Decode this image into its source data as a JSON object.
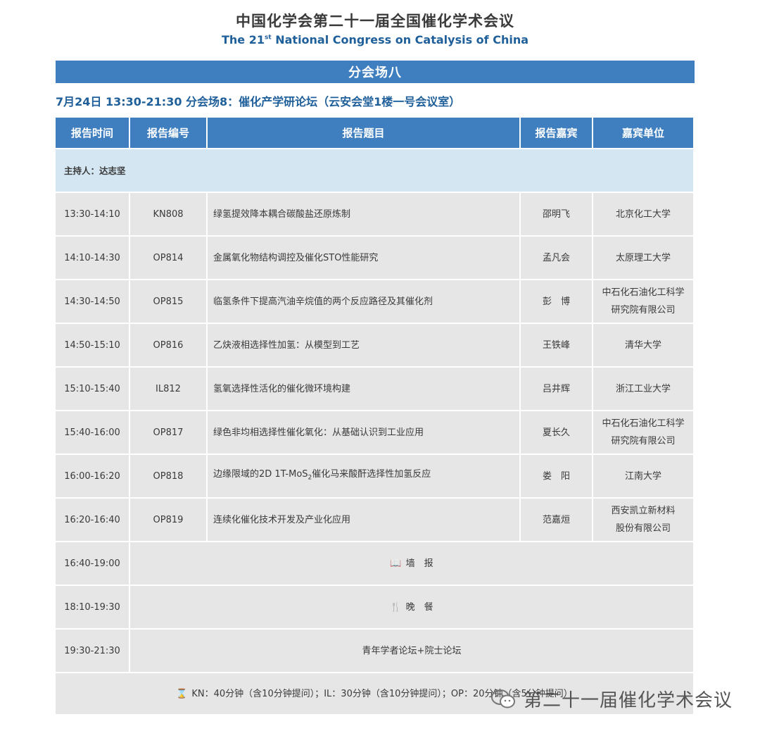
{
  "header": {
    "title_cn": "中国化学会第二十一届全国催化学术会议",
    "title_en_prefix": "The 21",
    "title_en_sup": "st",
    "title_en_suffix": " National Congress on Catalysis of China"
  },
  "banner": "分会场八",
  "session_line": "7月24日  13:30-21:30  分会场8：催化产学研论坛（云安会堂1楼一号会议室）",
  "table": {
    "headers": [
      "报告时间",
      "报告编号",
      "报告题目",
      "报告嘉宾",
      "嘉宾单位"
    ],
    "host": "主持人：达志坚",
    "rows": [
      {
        "time": "13:30-14:10",
        "code": "KN808",
        "topic": "绿氢提效降本耦合碳酸盐还原炼制",
        "speaker": "邵明飞",
        "org1": "北京化工大学",
        "org2": ""
      },
      {
        "time": "14:10-14:30",
        "code": "OP814",
        "topic": "金属氧化物结构调控及催化STO性能研究",
        "speaker": "孟凡会",
        "org1": "太原理工大学",
        "org2": ""
      },
      {
        "time": "14:30-14:50",
        "code": "OP815",
        "topic": "临氢条件下提高汽油辛烷值的两个反应路径及其催化剂",
        "speaker": "彭　博",
        "org1": "中石化石油化工科学",
        "org2": "研究院有限公司"
      },
      {
        "time": "14:50-15:10",
        "code": "OP816",
        "topic": "乙炔液相选择性加氢：从模型到工艺",
        "speaker": "王铁峰",
        "org1": "清华大学",
        "org2": ""
      },
      {
        "time": "15:10-15:40",
        "code": "IL812",
        "topic": "氢氧选择性活化的催化微环境构建",
        "speaker": "吕井辉",
        "org1": "浙江工业大学",
        "org2": ""
      },
      {
        "time": "15:40-16:00",
        "code": "OP817",
        "topic": "绿色非均相选择性催化氧化：从基础认识到工业应用",
        "speaker": "夏长久",
        "org1": "中石化石油化工科学",
        "org2": "研究院有限公司"
      },
      {
        "time": "16:00-16:20",
        "code": "OP818",
        "topic_pre": "边缘限域的2D 1T-MoS",
        "topic_sub": "2",
        "topic_post": "催化马来酸酐选择性加氢反应",
        "speaker": "娄　阳",
        "org1": "江南大学",
        "org2": ""
      },
      {
        "time": "16:20-16:40",
        "code": "OP819",
        "topic": "连续化催化技术开发及产业化应用",
        "speaker": "范嘉烜",
        "org1": "西安凯立新材料",
        "org2": "股份有限公司"
      }
    ],
    "breaks": [
      {
        "time": "16:40-19:00",
        "icon": "book-icon",
        "glyph": "📖",
        "label": "墙　报"
      },
      {
        "time": "18:10-19:30",
        "icon": "fork-knife-icon",
        "glyph": "🍴",
        "label": "晚　餐"
      },
      {
        "time": "19:30-21:30",
        "icon": "",
        "glyph": "",
        "label": "青年学者论坛+院士论坛"
      }
    ],
    "footer": {
      "icon": "hourglass-icon",
      "glyph": "⌛",
      "text": "KN：40分钟（含10分钟提问）；IL：30分钟（含10分钟提问）；OP：20分钟（含5分钟提问）"
    }
  },
  "watermark": "第二十一届催化学术会议",
  "colors": {
    "header_blue": "#3f7fbf",
    "title_blue": "#1f5f9a",
    "cell_gray": "#e6e6e6",
    "host_blue": "#d3e6f2"
  }
}
